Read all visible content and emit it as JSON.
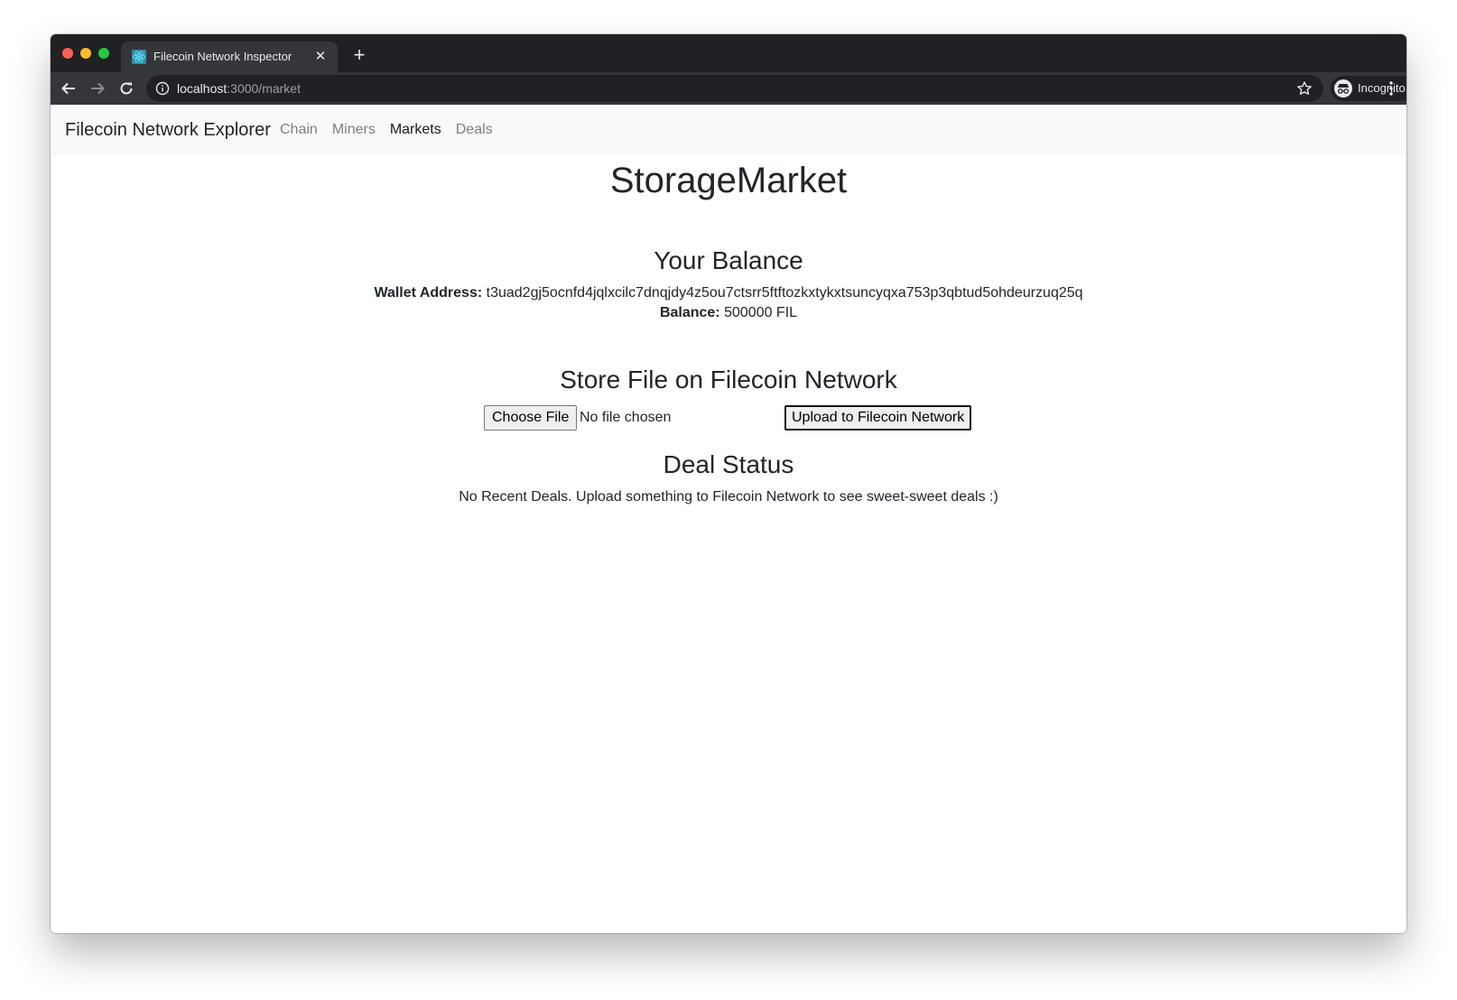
{
  "browser": {
    "tab_title": "Filecoin Network Inspector",
    "url_host": "localhost",
    "url_path": ":3000/market",
    "profile_label": "Incognito"
  },
  "navbar": {
    "brand": "Filecoin Network Explorer",
    "links": [
      {
        "label": "Chain",
        "active": false
      },
      {
        "label": "Miners",
        "active": false
      },
      {
        "label": "Markets",
        "active": true
      },
      {
        "label": "Deals",
        "active": false
      }
    ]
  },
  "main": {
    "title": "StorageMarket",
    "balance_section": {
      "heading": "Your Balance",
      "wallet_label": "Wallet Address:",
      "wallet_address": "t3uad2gj5ocnfd4jqlxcilc7dnqjdy4z5ou7ctsrr5ftftozkxtykxtsuncyqxa753p3qbtud5ohdeurzuq25q",
      "balance_label": "Balance:",
      "balance_value": "500000 FIL"
    },
    "store_section": {
      "heading": "Store File on Filecoin Network",
      "choose_file_label": "Choose File",
      "no_file_text": "No file chosen",
      "upload_label": "Upload to Filecoin Network"
    },
    "deal_section": {
      "heading": "Deal Status",
      "message": "No Recent Deals. Upload something to Filecoin Network to see sweet-sweet deals :)"
    }
  },
  "colors": {
    "tabstrip": "#202124",
    "toolbar": "#35363a",
    "navbar_bg": "#f8f9fa",
    "text": "#212529"
  }
}
